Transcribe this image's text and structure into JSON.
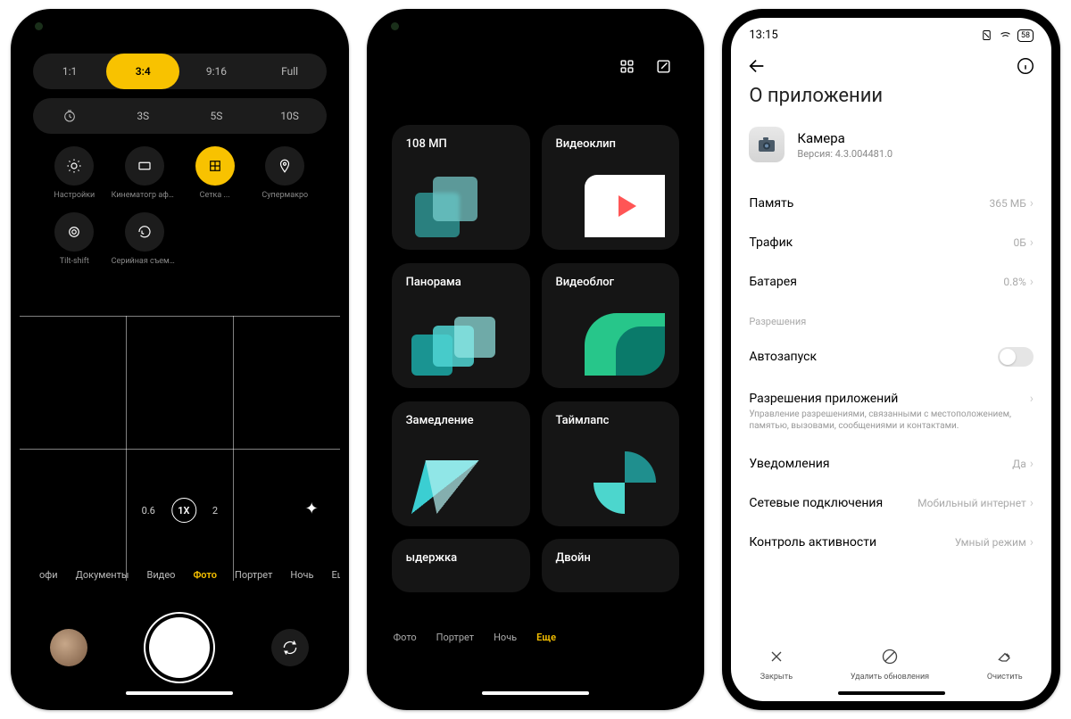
{
  "phone1": {
    "ratios": [
      "1:1",
      "3:4",
      "9:16",
      "Full"
    ],
    "ratio_active": 1,
    "timers": [
      "",
      "3S",
      "5S",
      "10S"
    ],
    "quick": [
      {
        "label": "Настройки",
        "icon": "settings"
      },
      {
        "label": "Кинематогр афический ...",
        "icon": "screen"
      },
      {
        "label": "Сетка ...",
        "icon": "grid",
        "active": true
      },
      {
        "label": "Супермакро",
        "icon": "macro"
      },
      {
        "label": "Tilt-shift",
        "icon": "tilt"
      },
      {
        "label": "Серийная съемка с та...",
        "icon": "burst"
      }
    ],
    "zoom": [
      "0.6",
      "1X",
      "2"
    ],
    "zoom_active": 1,
    "modes": [
      "офи",
      "Документы",
      "Видео",
      "Фото",
      "Портрет",
      "Ночь",
      "Еще"
    ],
    "mode_active": 3
  },
  "phone2": {
    "cards": [
      {
        "t": "108 МП",
        "a": "teal-squares"
      },
      {
        "t": "Видеоклип",
        "a": "play-white"
      },
      {
        "t": "Панорама",
        "a": "cyan-squares"
      },
      {
        "t": "Видеоблог",
        "a": "green-wave"
      },
      {
        "t": "Замедление",
        "a": "cyan-x"
      },
      {
        "t": "Таймлапс",
        "a": "teal-quarter"
      },
      {
        "t": "ыдержка",
        "a": "",
        "cut": true
      },
      {
        "t": "Двойн",
        "a": "",
        "cut": true
      }
    ],
    "modes": [
      "Фото",
      "Портрет",
      "Ночь",
      "Еще"
    ],
    "mode_active": 3
  },
  "phone3": {
    "time": "13:15",
    "battery": "58",
    "title": "О приложении",
    "app_name": "Камера",
    "app_version": "Версия: 4.3.004481.0",
    "rows": [
      {
        "l": "Память",
        "v": "365 МБ"
      },
      {
        "l": "Трафик",
        "v": "0Б"
      },
      {
        "l": "Батарея",
        "v": "0.8%"
      }
    ],
    "section": "Разрешения",
    "autostart": "Автозапуск",
    "perm_title": "Разрешения приложений",
    "perm_sub": "Управление разрешениями, связанными с местоположением, памятью, вызовами, сообщениями и контактами.",
    "rows2": [
      {
        "l": "Уведомления",
        "v": "Да"
      },
      {
        "l": "Сетевые подключения",
        "v": "Мобильный интернет"
      },
      {
        "l": "Контроль активности",
        "v": "Умный режим"
      }
    ],
    "actions": [
      {
        "l": "Закрыть",
        "i": "close"
      },
      {
        "l": "Удалить обновления",
        "i": "deny"
      },
      {
        "l": "Очистить",
        "i": "erase"
      }
    ]
  }
}
